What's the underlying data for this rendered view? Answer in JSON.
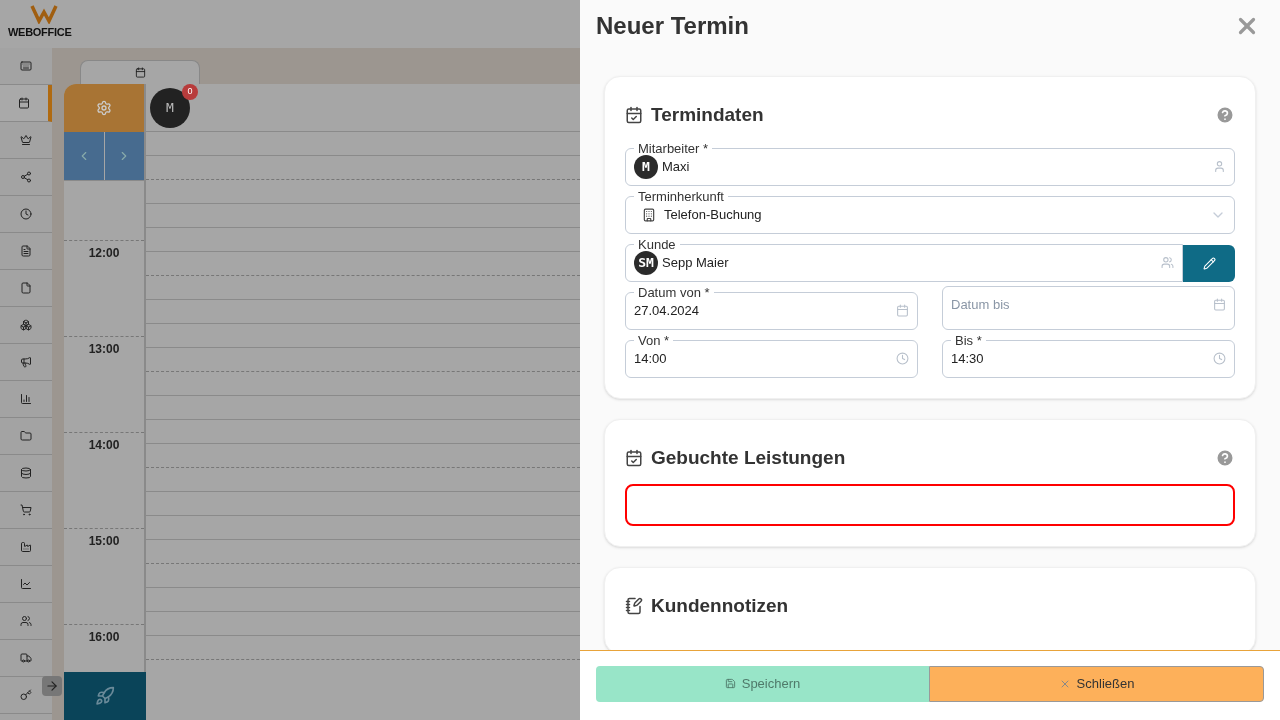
{
  "app": {
    "logo_text": "WEBOFFICE"
  },
  "sidebar": {
    "items": [
      {
        "selected": false
      },
      {
        "selected": true
      },
      {
        "selected": false
      },
      {
        "selected": false
      },
      {
        "selected": false
      },
      {
        "selected": false
      },
      {
        "selected": false
      },
      {
        "selected": false
      },
      {
        "selected": false
      },
      {
        "selected": false
      },
      {
        "selected": false
      },
      {
        "selected": false
      },
      {
        "selected": false
      },
      {
        "selected": false
      },
      {
        "selected": false
      },
      {
        "selected": false
      },
      {
        "selected": false
      },
      {
        "selected": false
      }
    ]
  },
  "calendar": {
    "employee": {
      "initial": "M",
      "badge": "0"
    },
    "hours": [
      "12:00",
      "13:00",
      "14:00",
      "15:00",
      "16:00"
    ]
  },
  "dialog": {
    "title": "Neuer Termin",
    "sections": [
      {
        "title": "Termindaten",
        "fields": [
          {
            "kind": "employee",
            "label": "Mitarbeiter *",
            "initials": "M",
            "value": "Maxi"
          },
          {
            "kind": "select",
            "label": "Terminherkunft",
            "value": "Telefon-Buchung"
          },
          {
            "kind": "customer",
            "label": "Kunde",
            "initials": "SM",
            "value": "Sepp Maier"
          },
          {
            "kind": "pair",
            "items": [
              {
                "kind": "date",
                "label": "Datum von *",
                "value": "27.04.2024"
              },
              {
                "kind": "date",
                "placeholder": "Datum bis"
              }
            ]
          },
          {
            "kind": "pair",
            "items": [
              {
                "kind": "time",
                "label": "Von *",
                "value": "14:00"
              },
              {
                "kind": "time",
                "label": "Bis *",
                "value": "14:30"
              }
            ]
          }
        ]
      },
      {
        "title": "Gebuchte Leistungen",
        "fields": [
          {
            "kind": "empty",
            "invalid": true
          }
        ]
      },
      {
        "title": "Kundennotizen"
      }
    ],
    "buttons": [
      {
        "label": "Speichern",
        "kind": "save",
        "disabled": true
      },
      {
        "label": "Schließen",
        "kind": "close",
        "disabled": false
      }
    ]
  }
}
